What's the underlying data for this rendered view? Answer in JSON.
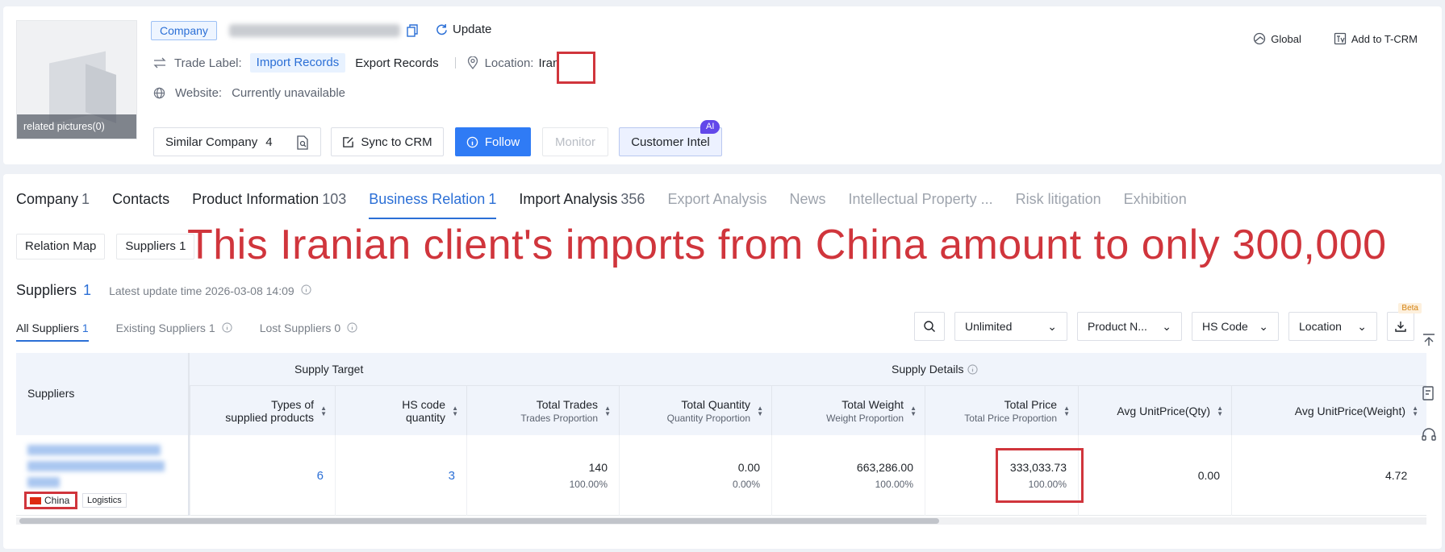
{
  "header": {
    "company_tag": "Company",
    "update_label": "Update",
    "trade_label_title": "Trade Label:",
    "import_records": "Import Records",
    "export_records": "Export Records",
    "location_title": "Location:",
    "location_value": "Iran",
    "website_title": "Website:",
    "website_value": "Currently unavailable",
    "related_pictures": "related pictures(0)",
    "global_label": "Global",
    "add_tcrm_label": "Add to T-CRM",
    "similar_company_label": "Similar Company",
    "similar_company_count": "4",
    "sync_crm_label": "Sync to CRM",
    "follow_label": "Follow",
    "monitor_label": "Monitor",
    "customer_intel_label": "Customer Intel",
    "ai_badge": "AI"
  },
  "tabs": [
    {
      "label": "Company",
      "count": "1"
    },
    {
      "label": "Contacts",
      "count": ""
    },
    {
      "label": "Product Information",
      "count": "103"
    },
    {
      "label": "Business Relation",
      "count": "1"
    },
    {
      "label": "Import Analysis",
      "count": "356"
    },
    {
      "label": "Export Analysis",
      "count": ""
    },
    {
      "label": "News",
      "count": ""
    },
    {
      "label": "Intellectual Property ...",
      "count": ""
    },
    {
      "label": "Risk litigation",
      "count": ""
    },
    {
      "label": "Exhibition",
      "count": ""
    }
  ],
  "subtabs": {
    "relation_map": "Relation Map",
    "suppliers": "Suppliers 1"
  },
  "banner_text": "This Iranian client's imports from China amount to only 300,000",
  "suppliers_section": {
    "title": "Suppliers",
    "count": "1",
    "latest_update": "Latest update time 2026-03-08 14:09"
  },
  "filter_tabs": {
    "all_label": "All Suppliers",
    "all_count": "1",
    "existing_label": "Existing Suppliers",
    "existing_count": "1",
    "lost_label": "Lost Suppliers",
    "lost_count": "0"
  },
  "tools": {
    "unlimited": "Unlimited",
    "product": "Product N...",
    "hs_code": "HS Code",
    "location": "Location",
    "beta": "Beta"
  },
  "table": {
    "suppliers_header": "Suppliers",
    "group_supply_target": "Supply Target",
    "group_supply_details": "Supply Details",
    "col_types_1": "Types of",
    "col_types_2": "supplied products",
    "col_hs_1": "HS code",
    "col_hs_2": "quantity",
    "col_trades": "Total Trades",
    "col_trades_sub": "Trades Proportion",
    "col_qty": "Total Quantity",
    "col_qty_sub": "Quantity Proportion",
    "col_weight": "Total Weight",
    "col_weight_sub": "Weight Proportion",
    "col_price": "Total Price",
    "col_price_sub": "Total Price Proportion",
    "col_avg_qty": "Avg UnitPrice(Qty)",
    "col_avg_weight": "Avg UnitPrice(Weight)",
    "row": {
      "country": "China",
      "tag": "Logistics",
      "types": "6",
      "hs_qty": "3",
      "trades": "140",
      "trades_pct": "100.00%",
      "quantity": "0.00",
      "quantity_pct": "0.00%",
      "weight": "663,286.00",
      "weight_pct": "100.00%",
      "price": "333,033.73",
      "price_pct": "100.00%",
      "avg_qty": "0.00",
      "avg_weight": "4.72"
    }
  },
  "colors": {
    "accent": "#2f7bf5",
    "highlight": "#d0353c",
    "ai_purple": "#6248ea"
  }
}
